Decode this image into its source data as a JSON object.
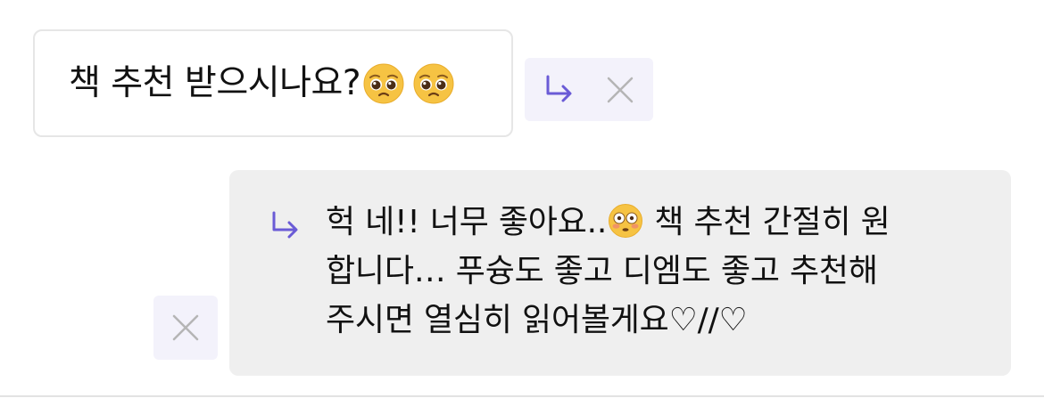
{
  "question": {
    "text": "책 추천 받으시나요?",
    "emojis": [
      "pleading-face-emoji",
      "pleading-face-emoji"
    ]
  },
  "answer": {
    "lines": [
      [
        "헉 네!! 너무 좋아요..",
        "flushed-face-emoji",
        " 책 추천 간절히 원"
      ],
      [
        "합니다… 푸슝도 좋고 디엠도 좋고 추천해"
      ],
      [
        "주시면 열심히 읽어볼게요♡//♡"
      ]
    ],
    "line1_before_emoji": "헉 네!! 너무 좋아요..",
    "line1_after_emoji": " 책 추천 간절히 원",
    "line2": "합니다… 푸슝도 좋고 디엠도 좋고 추천해",
    "line3": "주시면 열심히 읽어볼게요♡//♡"
  },
  "icons": {
    "reply": "reply-arrow-icon",
    "close": "close-icon"
  },
  "colors": {
    "accent": "#6a5bd6",
    "close_gray": "#b5b5b5",
    "action_bg": "#f3f2fb",
    "answer_bg": "#efefef",
    "question_border": "#e6e6e6",
    "emoji_yellow": "#f6c343"
  }
}
